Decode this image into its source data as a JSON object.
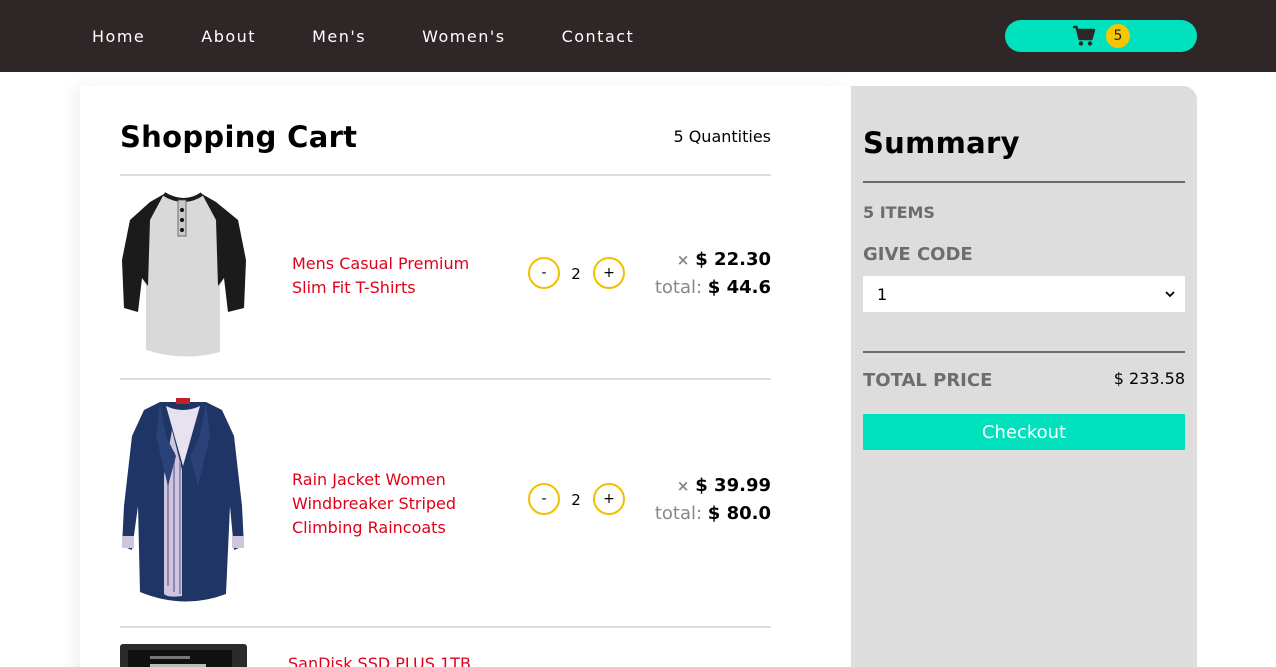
{
  "nav": {
    "links": [
      "Home",
      "About",
      "Men's",
      "Women's",
      "Contact"
    ],
    "cart_count": "5"
  },
  "cart": {
    "title": "Shopping Cart",
    "quantities": "5 Quantities",
    "items": [
      {
        "name": "Mens Casual Premium Slim Fit T-Shirts",
        "qty": "2",
        "unit_price": "$ 22.30",
        "total_label": "total:",
        "total": "$ 44.6",
        "image": "raglan-henley-shirt"
      },
      {
        "name": "Rain Jacket Women Windbreaker Striped Climbing Raincoats",
        "qty": "2",
        "unit_price": "$ 39.99",
        "total_label": "total:",
        "total": "$ 80.0",
        "image": "navy-rain-jacket"
      },
      {
        "name": "SanDisk SSD PLUS 1TB",
        "image": "ssd-drive"
      }
    ],
    "minus": "-",
    "plus": "+",
    "times": "×"
  },
  "summary": {
    "title": "Summary",
    "items": "5 ITEMS",
    "code_label": "GIVE CODE",
    "code_value": "1",
    "total_label": "TOTAL PRICE",
    "total_value": "$ 233.58",
    "checkout": "Checkout"
  },
  "colors": {
    "nav_bg": "#2f2727",
    "accent": "#00e2bd",
    "badge": "#f7c600",
    "product_link": "#e0001b",
    "summary_bg": "#dddddd"
  }
}
